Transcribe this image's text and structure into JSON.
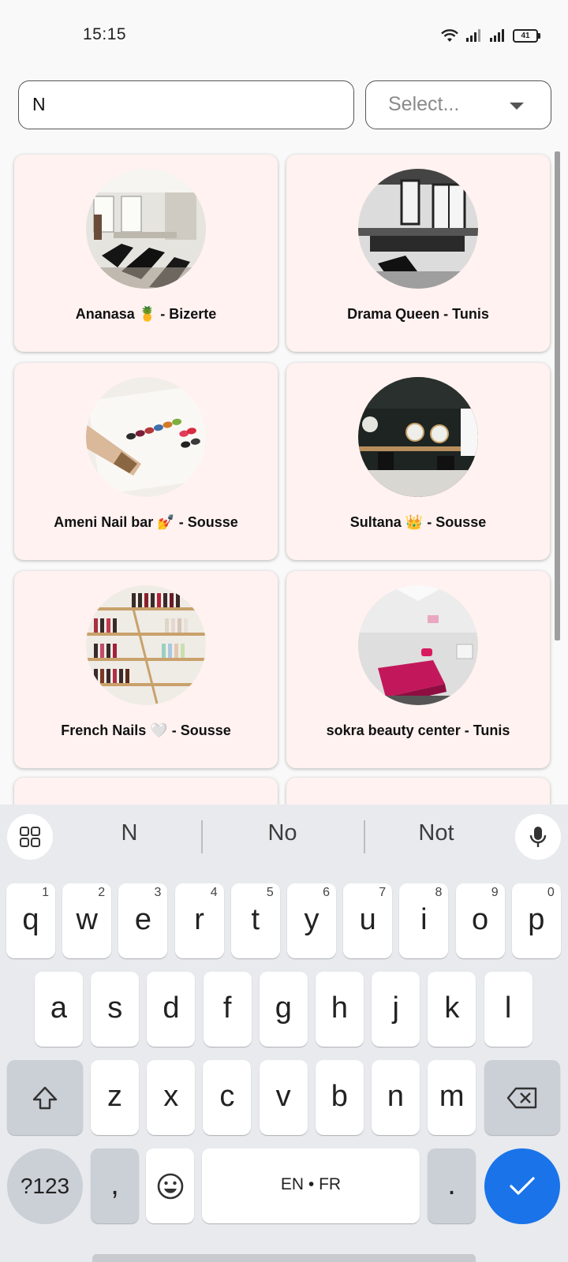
{
  "status_bar": {
    "time": "15:15",
    "battery": "41",
    "icons": [
      "wifi-icon",
      "signal-icon",
      "signal-icon",
      "battery-icon"
    ]
  },
  "search": {
    "value": "N",
    "select_placeholder": "Select..."
  },
  "salons": [
    {
      "name": "Ananasa 🍍 - Bizerte",
      "image": "salon-interior-photo"
    },
    {
      "name": "Drama Queen - Tunis",
      "image": "salon-interior-photo"
    },
    {
      "name": "Ameni Nail bar 💅 - Sousse",
      "image": "nail-color-swatches-photo"
    },
    {
      "name": "Sultana 👑 - Sousse",
      "image": "salon-interior-photo"
    },
    {
      "name": "French Nails 🤍 - Sousse",
      "image": "nail-polish-shelf-photo"
    },
    {
      "name": "sokra beauty center - Tunis",
      "image": "treatment-room-photo"
    }
  ],
  "keyboard": {
    "suggestions": [
      "N",
      "No",
      "Not"
    ],
    "row1": [
      {
        "k": "q",
        "h": "1"
      },
      {
        "k": "w",
        "h": "2"
      },
      {
        "k": "e",
        "h": "3"
      },
      {
        "k": "r",
        "h": "4"
      },
      {
        "k": "t",
        "h": "5"
      },
      {
        "k": "y",
        "h": "6"
      },
      {
        "k": "u",
        "h": "7"
      },
      {
        "k": "i",
        "h": "8"
      },
      {
        "k": "o",
        "h": "9"
      },
      {
        "k": "p",
        "h": "0"
      }
    ],
    "row2": [
      "a",
      "s",
      "d",
      "f",
      "g",
      "h",
      "j",
      "k",
      "l"
    ],
    "row3": [
      "z",
      "x",
      "c",
      "v",
      "b",
      "n",
      "m"
    ],
    "symbols_label": "?123",
    "comma": ",",
    "space_label": "EN • FR",
    "period": ".",
    "colors": {
      "enter": "#1a73e8",
      "card_bg": "#fff2f0"
    }
  }
}
